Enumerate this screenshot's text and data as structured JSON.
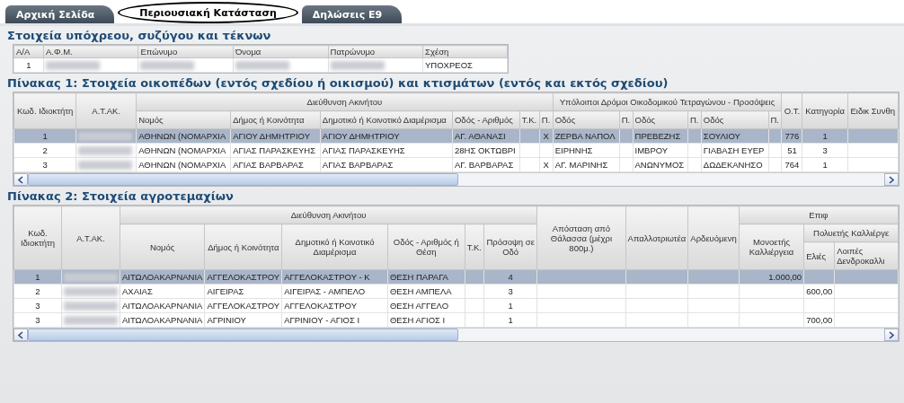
{
  "tabs": [
    {
      "label": "Αρχική Σελίδα",
      "selected": false
    },
    {
      "label": "Περιουσιακή Κατάσταση",
      "selected": true
    },
    {
      "label": "Δηλώσεις Ε9",
      "selected": false
    }
  ],
  "tables": [
    {
      "title": "Στοιχεία υπόχρεου, συζύγου και τέκνων",
      "horizontal_scrollbar": false,
      "header_rows": [
        [
          {
            "text": "Α/Α"
          },
          {
            "text": "Α.Φ.Μ."
          },
          {
            "text": "Επώνυμο"
          },
          {
            "text": "Όνομα"
          },
          {
            "text": "Πατρώνυμο"
          },
          {
            "text": "Σχέση"
          }
        ]
      ],
      "rows": [
        {
          "cells": [
            "1",
            {
              "kind": "blurred"
            },
            {
              "kind": "blurred"
            },
            {
              "kind": "blurred"
            },
            {
              "kind": "blurred"
            },
            "ΥΠΟΧΡΕΟΣ"
          ]
        }
      ]
    },
    {
      "title": "Πίνακας 1: Στοιχεία οικοπέδων (εντός σχεδίου ή οικισμού) και κτισμάτων (εντός και εκτός σχεδίου)",
      "horizontal_scrollbar": true,
      "header_rows": [
        [
          {
            "text": "Κωδ. Ιδιοκτήτη",
            "rowspan": 2
          },
          {
            "text": "Α.Τ.ΑΚ.",
            "rowspan": 2
          },
          {
            "text": "Διεύθυνση Ακινήτου",
            "colspan": 6
          },
          {
            "text": "Υπόλοιποι Δρόμοι Οικοδομικού Τετραγώνου - Προσόψεις",
            "colspan": 6
          },
          {
            "text": "Ο.Τ.",
            "rowspan": 2
          },
          {
            "text": "Κατηγορία",
            "rowspan": 2
          },
          {
            "text": "Ειδικ Συνθη",
            "rowspan": 2
          }
        ],
        [
          {
            "text": "Νομός"
          },
          {
            "text": "Δήμος ή Κοινότητα"
          },
          {
            "text": "Δημοτικό ή Κοινοτικό Διαμέρισμα"
          },
          {
            "text": "Οδός - Αριθμός"
          },
          {
            "text": "Τ.Κ."
          },
          {
            "text": "Π."
          },
          {
            "text": "Οδός"
          },
          {
            "text": "Π."
          },
          {
            "text": "Οδός"
          },
          {
            "text": "Π."
          },
          {
            "text": "Οδός"
          },
          {
            "text": "Π."
          }
        ]
      ],
      "rows": [
        {
          "selected": true,
          "cells": [
            "1",
            {
              "kind": "blurred"
            },
            "ΑΘΗΝΩΝ (ΝΟΜΑΡΧΙΑ",
            "ΑΓΙΟΥ ΔΗΜΗΤΡΙΟΥ",
            "ΑΓΙΟΥ ΔΗΜΗΤΡΙΟΥ",
            "ΑΓ. ΑΘΑΝΑΣΙ",
            null,
            "Χ",
            "ΖΕΡΒΑ ΝΑΠΟΛ",
            null,
            "ΠΡΕΒΕΖΗΣ",
            null,
            "ΣΟΥΛΙΟΥ",
            null,
            "776",
            "1",
            null
          ]
        },
        {
          "selected": false,
          "cells": [
            "2",
            {
              "kind": "blurred"
            },
            "ΑΘΗΝΩΝ (ΝΟΜΑΡΧΙΑ",
            "ΑΓΙΑΣ ΠΑΡΑΣΚΕΥΗΣ",
            "ΑΓΙΑΣ ΠΑΡΑΣΚΕΥΗΣ",
            "28ΗΣ ΟΚΤΩΒΡΙ",
            null,
            null,
            "ΕΙΡΗΝΗΣ",
            null,
            "ΙΜΒΡΟΥ",
            null,
            "ΓΙΑΒΑΣΗ ΕΥΕΡ",
            null,
            "51",
            "3",
            null
          ]
        },
        {
          "selected": false,
          "cells": [
            "3",
            {
              "kind": "blurred"
            },
            "ΑΘΗΝΩΝ (ΝΟΜΑΡΧΙΑ",
            "ΑΓΙΑΣ ΒΑΡΒΑΡΑΣ",
            "ΑΓΙΑΣ ΒΑΡΒΑΡΑΣ",
            "ΑΓ. ΒΑΡΒΑΡΑΣ",
            null,
            "Χ",
            "ΑΓ. ΜΑΡΙΝΗΣ",
            null,
            "ΑΝΩΝΥΜΟΣ",
            null,
            "ΔΩΔΕΚΑΝΗΣΟ",
            null,
            "764",
            "1",
            null
          ]
        }
      ]
    },
    {
      "title": "Πίνακας 2: Στοιχεία αγροτεμαχίων",
      "horizontal_scrollbar": true,
      "header_rows": [
        [
          {
            "text": "Κωδ. Ιδιοκτήτη",
            "rowspan": 3
          },
          {
            "text": "Α.Τ.ΑΚ.",
            "rowspan": 3
          },
          {
            "text": "Διεύθυνση Ακινήτου",
            "colspan": 6
          },
          {
            "text": "Απόσταση από Θάλασσα (μέχρι 800μ.)",
            "rowspan": 3
          },
          {
            "text": "Απαλλοτριωτέα",
            "rowspan": 3
          },
          {
            "text": "Αρδευόμενη",
            "rowspan": 3
          },
          {
            "text": "Επιφ",
            "colspan": 3
          }
        ],
        [
          {
            "text": "Νομός",
            "rowspan": 2
          },
          {
            "text": "Δήμος ή Κοινότητα",
            "rowspan": 2
          },
          {
            "text": "Δημοτικό ή Κοινοτικό Διαμέρισμα",
            "rowspan": 2
          },
          {
            "text": "Οδός - Αριθμός ή Θέση",
            "rowspan": 2
          },
          {
            "text": "Τ.Κ.",
            "rowspan": 2
          },
          {
            "text": "Πρόσοψη σε Οδό",
            "rowspan": 2
          },
          {
            "text": "Μονοετής Καλλιέργεια",
            "rowspan": 2
          },
          {
            "text": "Πολυετής Καλλιέργε",
            "colspan": 2
          }
        ],
        [
          {
            "text": "Ελιές"
          },
          {
            "text": "Λοιπές Δενδροκαλλι"
          }
        ]
      ],
      "rows": [
        {
          "selected": true,
          "cells": [
            "1",
            {
              "kind": "blurred"
            },
            "ΑΙΤΩΛΟΑΚΑΡΝΑΝΙΑ",
            "ΑΓΓΕΛΟΚΑΣΤΡΟΥ",
            "ΑΓΓΕΛΟΚΑΣΤΡΟΥ - Κ",
            "ΘΕΣΗ ΠΑΡΑΓΑ",
            null,
            "4",
            null,
            null,
            null,
            "1.000,00",
            null,
            null
          ]
        },
        {
          "selected": false,
          "cells": [
            "2",
            {
              "kind": "blurred"
            },
            "ΑΧΑΙΑΣ",
            "ΑΙΓΕΙΡΑΣ",
            "ΑΙΓΕΙΡΑΣ - ΑΜΠΕΛΟ",
            "ΘΕΣΗ ΑΜΠΕΛΑ",
            null,
            "3",
            null,
            null,
            null,
            null,
            "600,00",
            null
          ]
        },
        {
          "selected": false,
          "cells": [
            "3",
            {
              "kind": "blurred"
            },
            "ΑΙΤΩΛΟΑΚΑΡΝΑΝΙΑ",
            "ΑΓΓΕΛΟΚΑΣΤΡΟΥ",
            "ΑΓΓΕΛΟΚΑΣΤΡΟΥ",
            "ΘΕΣΗ ΑΓΓΕΛΟ",
            null,
            "1",
            null,
            null,
            null,
            null,
            null,
            null
          ]
        },
        {
          "selected": false,
          "cells": [
            "3",
            {
              "kind": "blurred"
            },
            "ΑΙΤΩΛΟΑΚΑΡΝΑΝΙΑ",
            "ΑΓΡΙΝΙΟΥ",
            "ΑΓΡΙΝΙΟΥ - ΑΓΙΟΣ Ι",
            "ΘΕΣΗ ΑΓΙΟΣ Ι",
            null,
            "1",
            null,
            null,
            null,
            null,
            "700,00",
            null
          ]
        }
      ]
    }
  ]
}
